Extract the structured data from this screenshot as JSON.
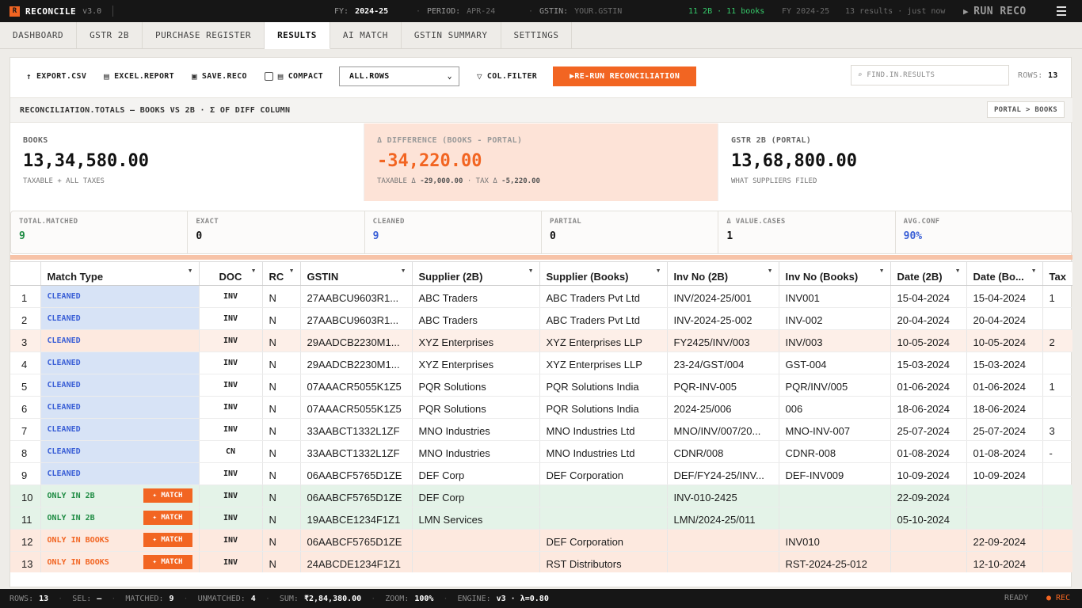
{
  "app": {
    "logo_letter": "R",
    "name": "RECONCILE",
    "version": "v3.0"
  },
  "topbar": {
    "fy_label": "FY:",
    "fy_value": "2024-25",
    "period_label": "PERIOD:",
    "period_value": "APR-24",
    "gstin_label": "GSTIN:",
    "gstin_value": "YOUR.GSTIN",
    "counts": "11 2B · 11 books",
    "fy2": "FY 2024-25",
    "results": "13 results · just now",
    "run_label": "RUN RECO"
  },
  "tabs": [
    "DASHBOARD",
    "GSTR 2B",
    "PURCHASE REGISTER",
    "RESULTS",
    "AI MATCH",
    "GSTIN SUMMARY",
    "SETTINGS"
  ],
  "toolbar": {
    "export_csv": "EXPORT.CSV",
    "excel_report": "EXCEL.REPORT",
    "save_reco": "SAVE.RECO",
    "compact": "COMPACT",
    "select_value": "ALL.ROWS",
    "col_filter": "COL.FILTER",
    "rerun": "▶RE-RUN RECONCILIATION",
    "search_placeholder": "⌕ FIND.IN.RESULTS",
    "rows_label": "ROWS:",
    "rows_value": "13"
  },
  "totals": {
    "title": "RECONCILIATION.TOTALS — BOOKS VS 2B · Σ OF DIFF COLUMN",
    "badge": "PORTAL > BOOKS",
    "books_label": "BOOKS",
    "books_value": "13,34,580.00",
    "books_sub": "TAXABLE + ALL TAXES",
    "diff_label": "Δ DIFFERENCE (BOOKS - PORTAL)",
    "diff_value": "-34,220.00",
    "diff_sub1": "TAXABLE Δ",
    "diff_sub1_val": "-29,000.00",
    "diff_sub2": "· TAX Δ",
    "diff_sub2_val": "-5,220.00",
    "portal_label": "GSTR 2B (PORTAL)",
    "portal_value": "13,68,800.00",
    "portal_sub": "WHAT SUPPLIERS FILED"
  },
  "stats": [
    {
      "label": "TOTAL.MATCHED",
      "value": "9"
    },
    {
      "label": "EXACT",
      "value": "0"
    },
    {
      "label": "CLEANED",
      "value": "9"
    },
    {
      "label": "PARTIAL",
      "value": "0"
    },
    {
      "label": "Δ VALUE.CASES",
      "value": "1"
    },
    {
      "label": "AVG.CONF",
      "value": "90%"
    }
  ],
  "table": {
    "headers": [
      "Match Type",
      "DOC",
      "RC",
      "GSTIN",
      "Supplier (2B)",
      "Supplier (Books)",
      "Inv No (2B)",
      "Inv No (Books)",
      "Date (2B)",
      "Date (Bo...",
      "Tax"
    ],
    "match_btn": "✦ MATCH",
    "rows": [
      {
        "n": "1",
        "type": "CLEANED",
        "doc": "INV",
        "rc": "N",
        "gstin": "27AABCU9603R1...",
        "s2b": "ABC Traders",
        "sbk": "ABC Traders Pvt Ltd",
        "i2b": "INV/2024-25/001",
        "ibk": "INV001",
        "d2b": "15-04-2024",
        "dbk": "15-04-2024",
        "tax": "1"
      },
      {
        "n": "2",
        "type": "CLEANED",
        "doc": "INV",
        "rc": "N",
        "gstin": "27AABCU9603R1...",
        "s2b": "ABC Traders",
        "sbk": "ABC Traders Pvt Ltd",
        "i2b": "INV-2024-25-002",
        "ibk": "INV-002",
        "d2b": "20-04-2024",
        "dbk": "20-04-2024",
        "tax": ""
      },
      {
        "n": "3",
        "type": "CLEANED",
        "doc": "INV",
        "rc": "N",
        "gstin": "29AADCB2230M1...",
        "s2b": "XYZ Enterprises",
        "sbk": "XYZ Enterprises LLP",
        "i2b": "FY2425/INV/003",
        "ibk": "INV/003",
        "d2b": "10-05-2024",
        "dbk": "10-05-2024",
        "tax": "2"
      },
      {
        "n": "4",
        "type": "CLEANED",
        "doc": "INV",
        "rc": "N",
        "gstin": "29AADCB2230M1...",
        "s2b": "XYZ Enterprises",
        "sbk": "XYZ Enterprises LLP",
        "i2b": "23-24/GST/004",
        "ibk": "GST-004",
        "d2b": "15-03-2024",
        "dbk": "15-03-2024",
        "tax": ""
      },
      {
        "n": "5",
        "type": "CLEANED",
        "doc": "INV",
        "rc": "N",
        "gstin": "07AAACR5055K1Z5",
        "s2b": "PQR Solutions",
        "sbk": "PQR Solutions India",
        "i2b": "PQR-INV-005",
        "ibk": "PQR/INV/005",
        "d2b": "01-06-2024",
        "dbk": "01-06-2024",
        "tax": "1"
      },
      {
        "n": "6",
        "type": "CLEANED",
        "doc": "INV",
        "rc": "N",
        "gstin": "07AAACR5055K1Z5",
        "s2b": "PQR Solutions",
        "sbk": "PQR Solutions India",
        "i2b": "2024-25/006",
        "ibk": "006",
        "d2b": "18-06-2024",
        "dbk": "18-06-2024",
        "tax": ""
      },
      {
        "n": "7",
        "type": "CLEANED",
        "doc": "INV",
        "rc": "N",
        "gstin": "33AABCT1332L1ZF",
        "s2b": "MNO Industries",
        "sbk": "MNO Industries Ltd",
        "i2b": "MNO/INV/007/20...",
        "ibk": "MNO-INV-007",
        "d2b": "25-07-2024",
        "dbk": "25-07-2024",
        "tax": "3"
      },
      {
        "n": "8",
        "type": "CLEANED",
        "doc": "CN",
        "rc": "N",
        "gstin": "33AABCT1332L1ZF",
        "s2b": "MNO Industries",
        "sbk": "MNO Industries Ltd",
        "i2b": "CDNR/008",
        "ibk": "CDNR-008",
        "d2b": "01-08-2024",
        "dbk": "01-08-2024",
        "tax": "-"
      },
      {
        "n": "9",
        "type": "CLEANED",
        "doc": "INV",
        "rc": "N",
        "gstin": "06AABCF5765D1ZE",
        "s2b": "DEF Corp",
        "sbk": "DEF Corporation",
        "i2b": "DEF/FY24-25/INV...",
        "ibk": "DEF-INV009",
        "d2b": "10-09-2024",
        "dbk": "10-09-2024",
        "tax": ""
      },
      {
        "n": "10",
        "type": "ONLY IN 2B",
        "doc": "INV",
        "rc": "N",
        "gstin": "06AABCF5765D1ZE",
        "s2b": "DEF Corp",
        "sbk": "",
        "i2b": "INV-010-2425",
        "ibk": "",
        "d2b": "22-09-2024",
        "dbk": "",
        "tax": ""
      },
      {
        "n": "11",
        "type": "ONLY IN 2B",
        "doc": "INV",
        "rc": "N",
        "gstin": "19AABCE1234F1Z1",
        "s2b": "LMN Services",
        "sbk": "",
        "i2b": "LMN/2024-25/011",
        "ibk": "",
        "d2b": "05-10-2024",
        "dbk": "",
        "tax": ""
      },
      {
        "n": "12",
        "type": "ONLY IN BOOKS",
        "doc": "INV",
        "rc": "N",
        "gstin": "06AABCF5765D1ZE",
        "s2b": "",
        "sbk": "DEF Corporation",
        "i2b": "",
        "ibk": "INV010",
        "d2b": "",
        "dbk": "22-09-2024",
        "tax": ""
      },
      {
        "n": "13",
        "type": "ONLY IN BOOKS",
        "doc": "INV",
        "rc": "N",
        "gstin": "24ABCDE1234F1Z1",
        "s2b": "",
        "sbk": "RST Distributors",
        "i2b": "",
        "ibk": "RST-2024-25-012",
        "d2b": "",
        "dbk": "12-10-2024",
        "tax": ""
      }
    ]
  },
  "status": {
    "rows_label": "ROWS:",
    "rows": "13",
    "sel_label": "SEL:",
    "sel": "—",
    "matched_label": "MATCHED:",
    "matched": "9",
    "unmatched_label": "UNMATCHED:",
    "unmatched": "4",
    "sum_label": "SUM:",
    "sum": "₹2,84,380.00",
    "zoom_label": "ZOOM:",
    "zoom": "100%",
    "engine_label": "ENGINE:",
    "engine": "v3 · λ=0.80",
    "ready": "READY",
    "rec": "● REC"
  }
}
